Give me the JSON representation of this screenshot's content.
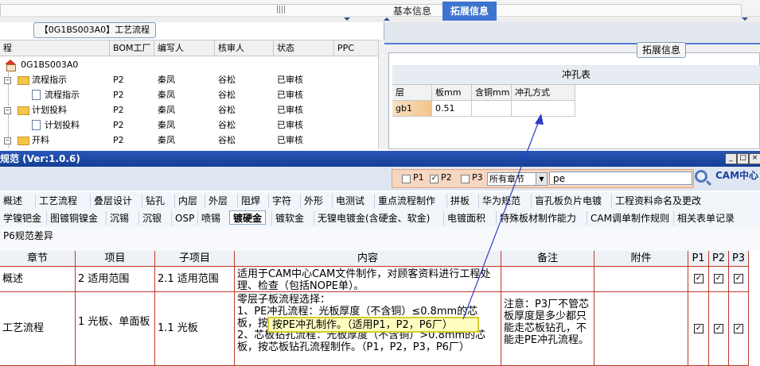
{
  "flow_panel": {
    "title": "【0G1BS003A0】工艺流程",
    "columns": [
      "程",
      "BOM工厂",
      "编写人",
      "核审人",
      "状态",
      "PPC"
    ],
    "rows": [
      {
        "name": "0G1BS003A0",
        "bom": "",
        "writer": "",
        "reviewer": "",
        "status": "",
        "ppc": ""
      },
      {
        "name": "流程指示",
        "bom": "P2",
        "writer": "秦凤",
        "reviewer": "谷松",
        "status": "已审核",
        "ppc": ""
      },
      {
        "name": "流程指示",
        "bom": "P2",
        "writer": "秦凤",
        "reviewer": "谷松",
        "status": "已审核",
        "ppc": ""
      },
      {
        "name": "计划投料",
        "bom": "P2",
        "writer": "秦凤",
        "reviewer": "谷松",
        "status": "已审核",
        "ppc": ""
      },
      {
        "name": "计划投料",
        "bom": "P2",
        "writer": "秦凤",
        "reviewer": "谷松",
        "status": "已审核",
        "ppc": ""
      },
      {
        "name": "开料",
        "bom": "P2",
        "writer": "秦凤",
        "reviewer": "谷松",
        "status": "已审核",
        "ppc": ""
      }
    ]
  },
  "info_panel": {
    "tabs": [
      "基本信息",
      "拓展信息"
    ],
    "group_title": "拓展信息",
    "table_title": "冲孔表",
    "columns": [
      "层",
      "板mm",
      "含铜mm",
      "冲孔方式"
    ],
    "row": {
      "layer": "gb1",
      "thickness": "0.51",
      "copper": "",
      "method": ""
    }
  },
  "window": {
    "title": "规范 (Ver:1.0.6)",
    "filter": {
      "p1_label": "P1",
      "p1_checked": "",
      "p2_label": "P2",
      "p2_checked": "✓",
      "p3_label": "P3",
      "p3_checked": "",
      "chapter_select": "所有章节",
      "search_value": "pe"
    },
    "logo_text": "CAM中心"
  },
  "tabs_row1": [
    "概述",
    "工艺流程",
    "叠层设计",
    "钻孔",
    "内层",
    "外层",
    "阻焊",
    "字符",
    "外形",
    "电测试",
    "重点流程制作",
    "拼板",
    "华为规范",
    "盲孔板负片电镀",
    "工程资料命名及更改"
  ],
  "tabs_row2": [
    "学镍钯金",
    "图镀铜镍金",
    "沉锡",
    "沉银",
    "OSP",
    "喷锡",
    "镀硬金",
    "镀软金",
    "无镍电镀金(含硬金、软金)",
    "电镀面积",
    "特殊板材制作能力",
    "CAM调单制作规则",
    "相关表单记录"
  ],
  "tabs_row2_active": "镀硬金",
  "tabs_row3": [
    "P6规范差异"
  ],
  "grid": {
    "columns": [
      "章节",
      "项目",
      "子项目",
      "内容",
      "备注",
      "附件",
      "P1",
      "P2",
      "P3"
    ],
    "rows": [
      {
        "chapter": "概述",
        "item": "2 适用范围",
        "subitem": "2.1 适用范围",
        "content": "适用于CAM中心CAM文件制作，对顾客资料进行工程处理、检查（包括NOPE单）。",
        "note": "",
        "attach": "",
        "p1": "✓",
        "p2": "✓",
        "p3": "✓"
      },
      {
        "chapter": "工艺流程",
        "item": "1 光板、单面板",
        "subitem": "1.1 光板",
        "content": "零层子板流程选择：\n1、PE冲孔流程：光板厚度（不含铜）≤0.8mm的芯板，按PE冲孔制作。（适用P1，P2，P6厂）\n2、芯板钻孔流程：光板厚度（不含铜）>0.8mm的芯板，按芯板钻孔流程制作。（P1，P2，P3，P6厂）",
        "note": "注意：P3厂不管芯板厚度是多少都只能走芯板钻孔，不能走PE冲孔流程。",
        "attach": "",
        "p1": "✓",
        "p2": "✓",
        "p3": "✓"
      }
    ]
  },
  "tooltip": "按PE冲孔制作。（适用P1，P2，P6厂）"
}
